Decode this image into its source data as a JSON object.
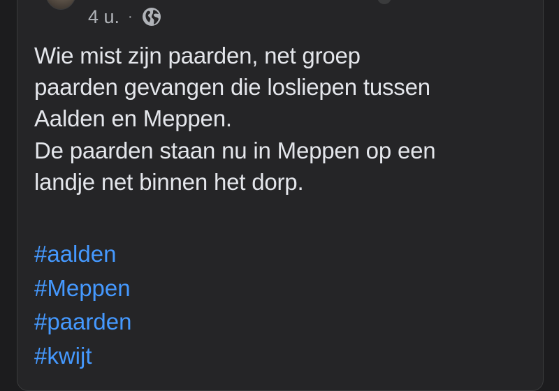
{
  "post": {
    "timestamp": "4 u.",
    "separator": "·",
    "audience_icon": "globe-icon",
    "body_lines": [
      "Wie mist zijn paarden, net groep",
      "paarden gevangen die losliepen tussen",
      "Aalden en Meppen.",
      "De paarden staan nu in Meppen op een",
      "landje net binnen het dorp."
    ],
    "hashtags": [
      "#aalden",
      "#Meppen",
      "#paarden",
      "#kwijt"
    ]
  },
  "colors": {
    "background": "#1c1c1e",
    "card": "#252527",
    "text": "#e4e6eb",
    "muted": "#b0b3b8",
    "link": "#4599ff"
  }
}
